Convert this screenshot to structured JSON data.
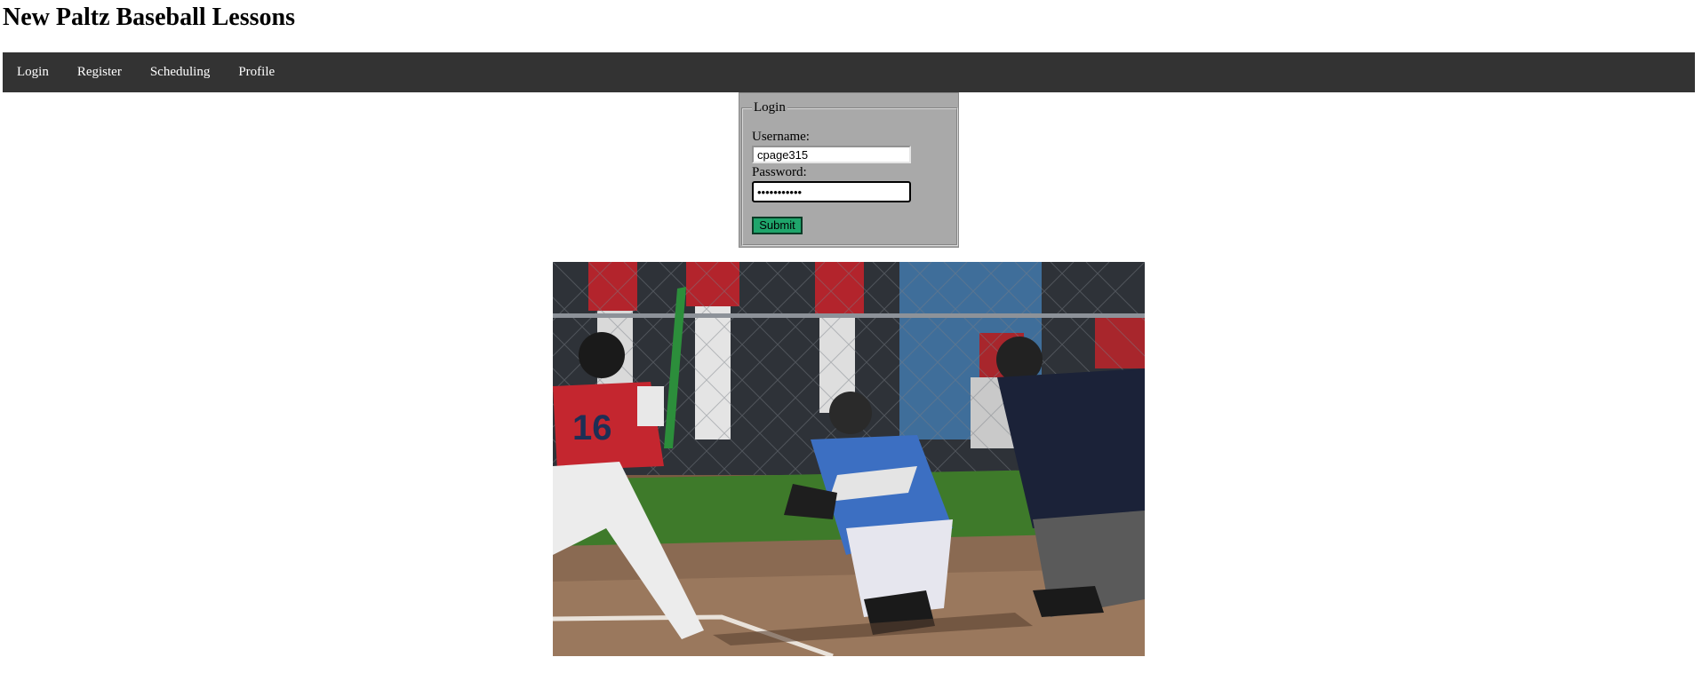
{
  "site": {
    "title": "New Paltz Baseball Lessons"
  },
  "nav": {
    "items": [
      {
        "label": "Login"
      },
      {
        "label": "Register"
      },
      {
        "label": "Scheduling"
      },
      {
        "label": "Profile"
      }
    ]
  },
  "login": {
    "legend": "Login",
    "username_label": "Username:",
    "username_value": "cpage315",
    "password_label": "Password:",
    "password_value": "•••••••••••",
    "submit_label": "Submit"
  },
  "colors": {
    "nav_bg": "#333333",
    "login_bg": "#a9a9a9",
    "submit_bg": "#1fa56b"
  },
  "photo": {
    "jersey_number": "16"
  }
}
